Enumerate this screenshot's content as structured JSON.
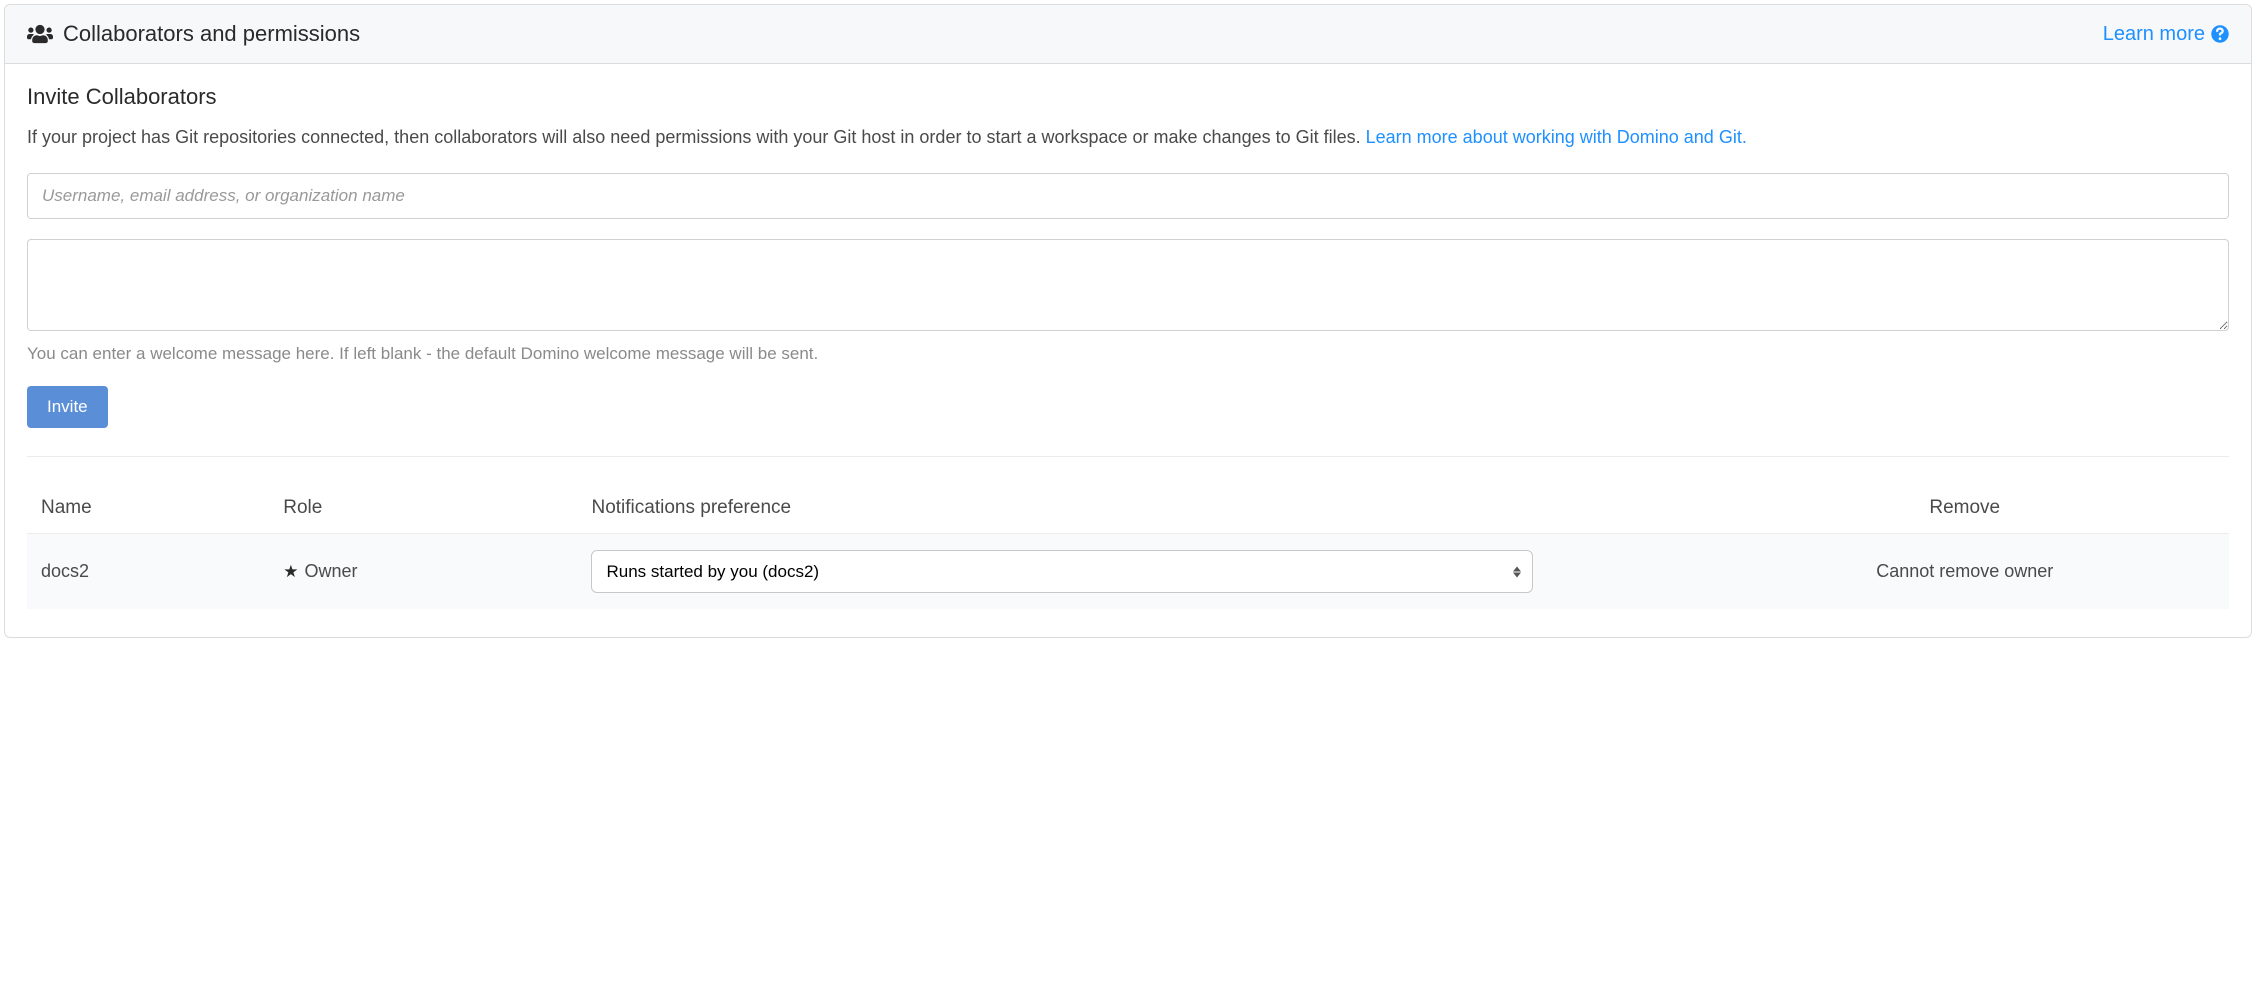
{
  "header": {
    "title": "Collaborators and permissions",
    "learn_more": "Learn more"
  },
  "invite": {
    "title": "Invite Collaborators",
    "description_prefix": "If your project has Git repositories connected, then collaborators will also need permissions with your Git host in order to start a workspace or make changes to Git files. ",
    "description_link": "Learn more about working with Domino and Git.",
    "input_placeholder": "Username, email address, or organization name",
    "message_helper": "You can enter a welcome message here. If left blank - the default Domino welcome message will be sent.",
    "button_label": "Invite"
  },
  "table": {
    "columns": {
      "name": "Name",
      "role": "Role",
      "notifications": "Notifications preference",
      "remove": "Remove"
    },
    "rows": [
      {
        "name": "docs2",
        "role": "Owner",
        "notification_selected": "Runs started by you (docs2)",
        "remove_text": "Cannot remove owner"
      }
    ]
  }
}
